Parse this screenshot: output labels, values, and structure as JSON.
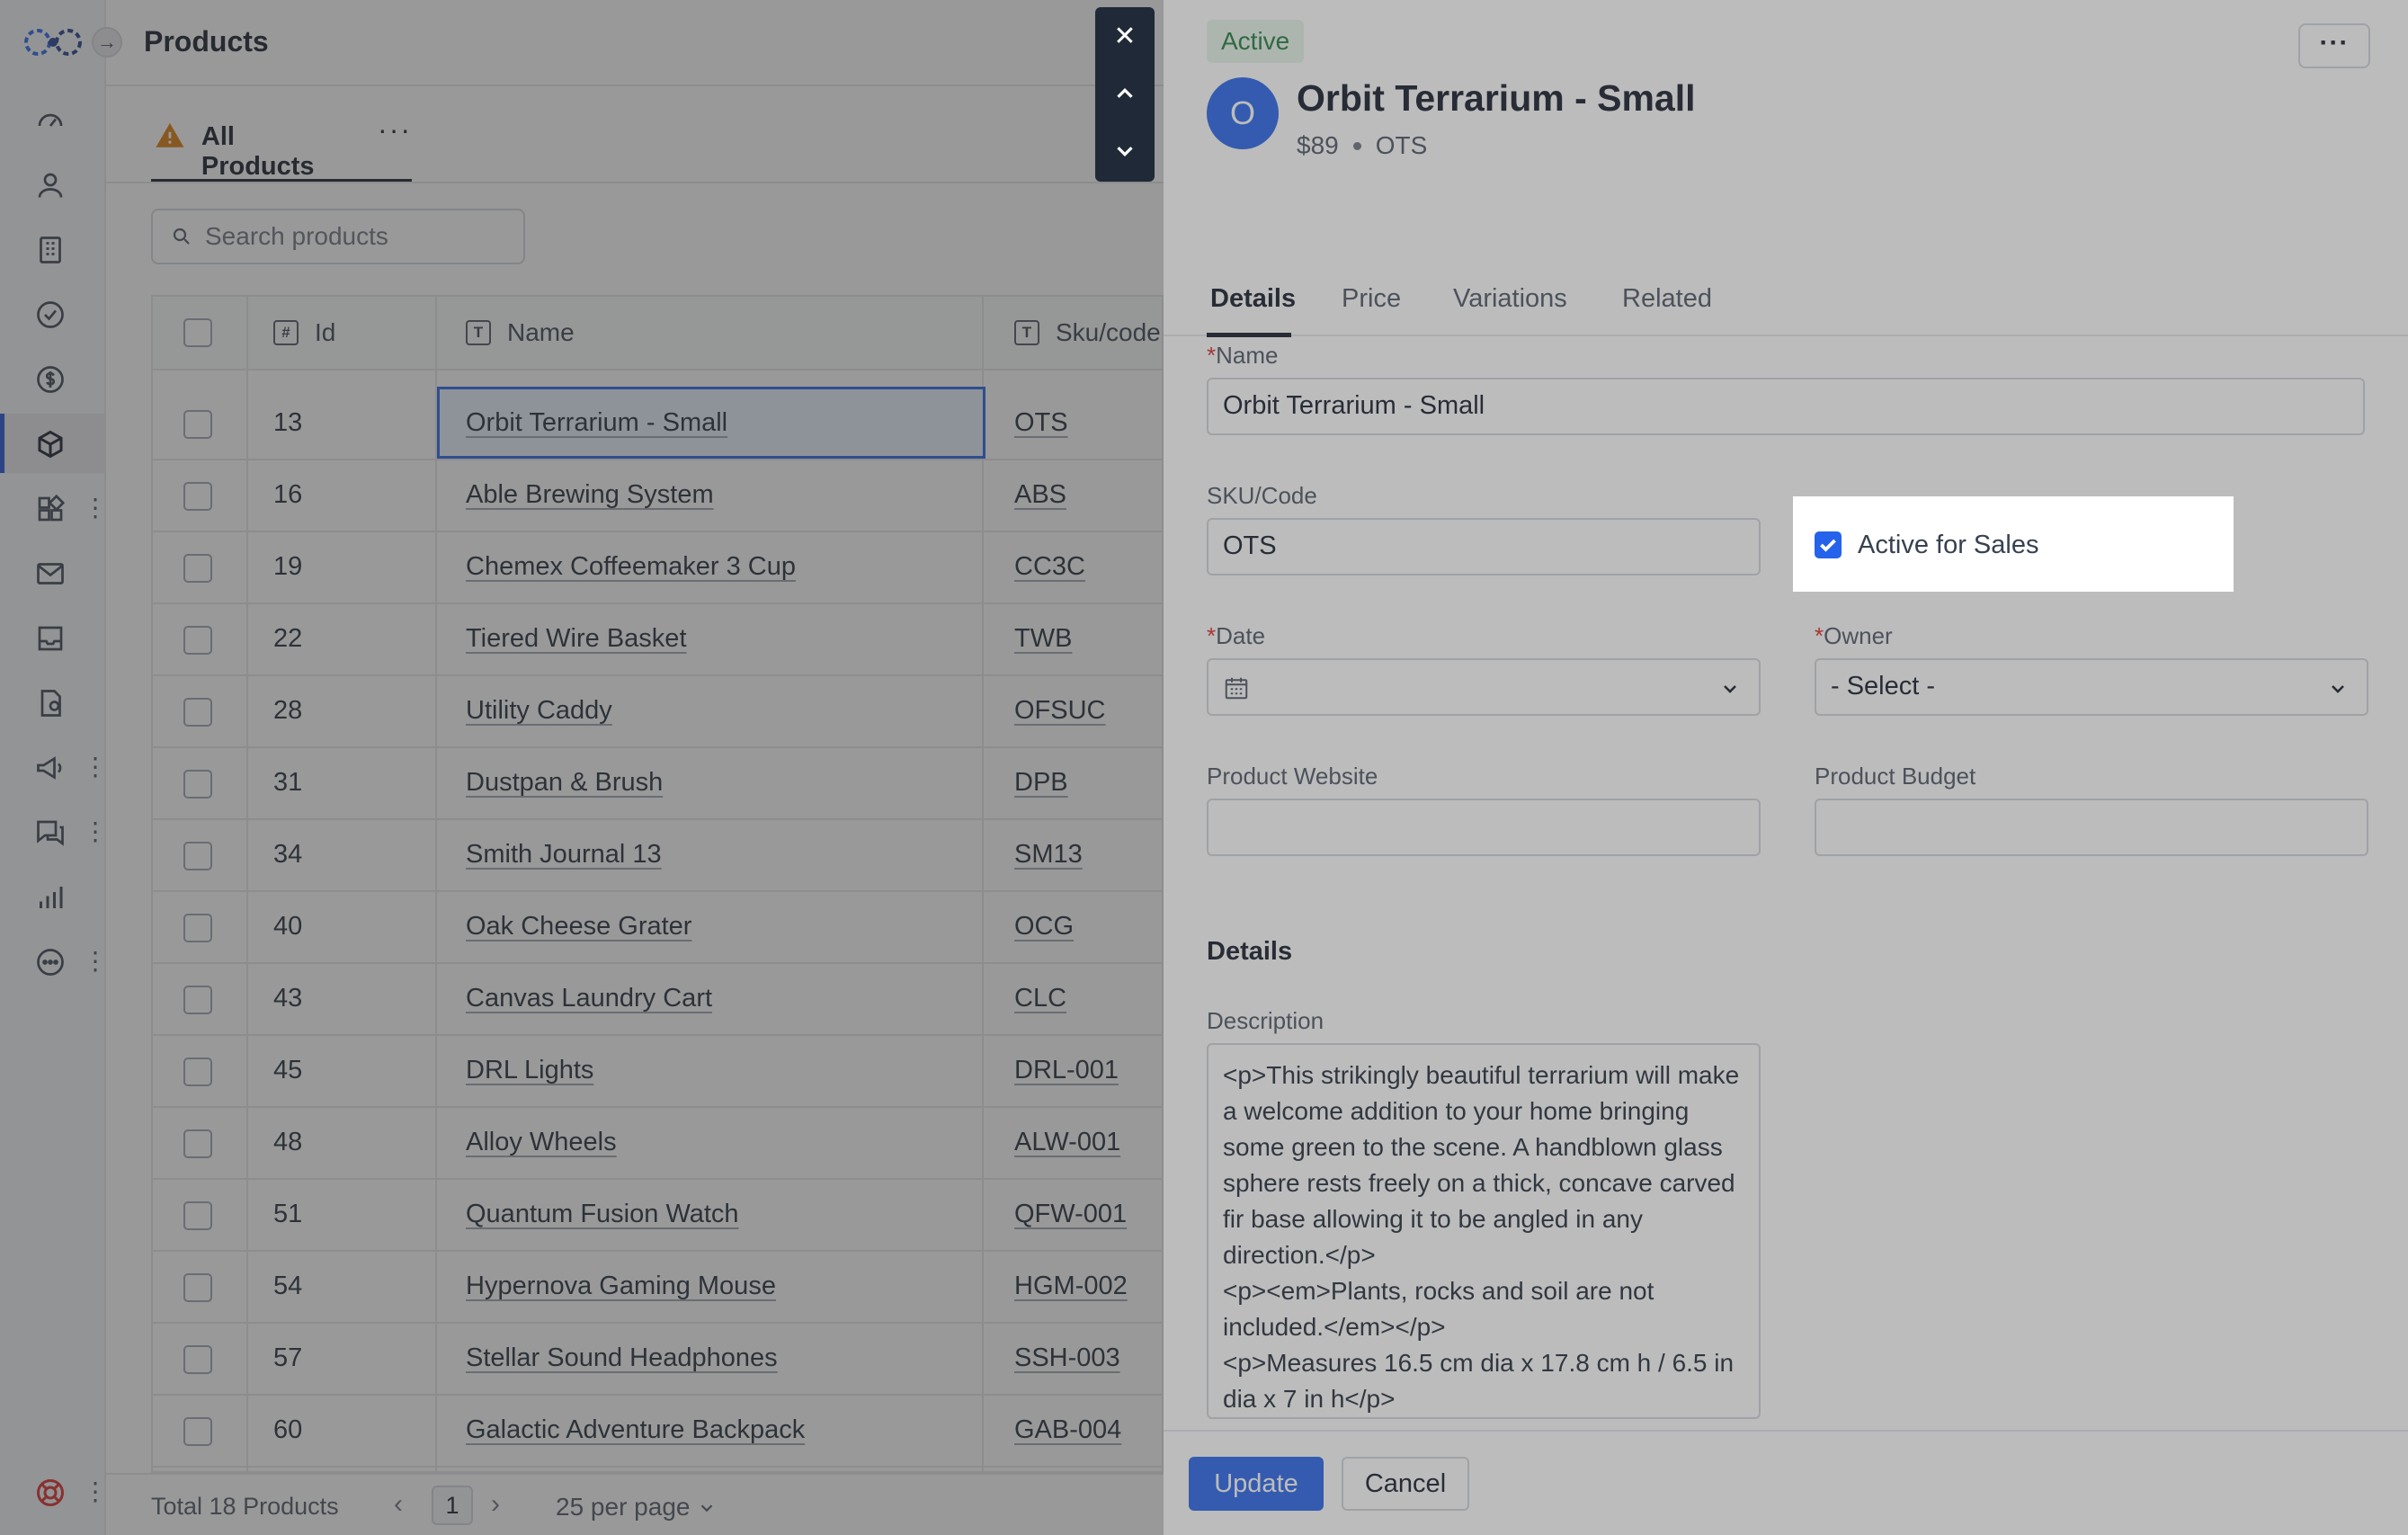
{
  "app": {
    "page_title": "Products",
    "view_tab_label": "All Products",
    "view_tab_more": "···",
    "collapse_glyph": "→"
  },
  "sidebar": {
    "icons": [
      "dashboard-icon",
      "contacts-icon",
      "companies-icon",
      "tasks-icon",
      "deals-icon",
      "products-icon",
      "apps-icon",
      "mail-icon",
      "inbox-icon",
      "documents-icon",
      "campaigns-icon",
      "chat-icon",
      "reports-icon",
      "more-icon",
      "help-icon"
    ],
    "dots": "⋮"
  },
  "search": {
    "placeholder": "Search products"
  },
  "table": {
    "columns": [
      {
        "icon": "#",
        "label": "Id"
      },
      {
        "icon": "T",
        "label": "Name"
      },
      {
        "icon": "T",
        "label": "Sku/code"
      }
    ],
    "rows": [
      {
        "id": "13",
        "name": "Orbit Terrarium - Small",
        "sku": "OTS"
      },
      {
        "id": "16",
        "name": "Able Brewing System",
        "sku": "ABS"
      },
      {
        "id": "19",
        "name": "Chemex Coffeemaker 3 Cup",
        "sku": "CC3C"
      },
      {
        "id": "22",
        "name": "Tiered Wire Basket",
        "sku": "TWB"
      },
      {
        "id": "28",
        "name": "Utility Caddy",
        "sku": "OFSUC"
      },
      {
        "id": "31",
        "name": "Dustpan & Brush",
        "sku": "DPB"
      },
      {
        "id": "34",
        "name": "Smith Journal 13",
        "sku": "SM13"
      },
      {
        "id": "40",
        "name": "Oak Cheese Grater",
        "sku": "OCG"
      },
      {
        "id": "43",
        "name": "Canvas Laundry Cart",
        "sku": "CLC"
      },
      {
        "id": "45",
        "name": "DRL Lights",
        "sku": "DRL-001"
      },
      {
        "id": "48",
        "name": "Alloy Wheels",
        "sku": "ALW-001"
      },
      {
        "id": "51",
        "name": "Quantum Fusion Watch",
        "sku": "QFW-001"
      },
      {
        "id": "54",
        "name": "Hypernova Gaming Mouse",
        "sku": "HGM-002"
      },
      {
        "id": "57",
        "name": "Stellar Sound Headphones",
        "sku": "SSH-003"
      },
      {
        "id": "60",
        "name": "Galactic Adventure Backpack",
        "sku": "GAB-004"
      }
    ]
  },
  "footer": {
    "total": "Total 18 Products",
    "prev": "‹",
    "current_page": "1",
    "next": "›",
    "per_page": "25 per page"
  },
  "record_nav": {
    "close": "✕"
  },
  "drawer": {
    "status": "Active",
    "kebab": "···",
    "avatar_initial": "O",
    "title": "Orbit Terrarium - Small",
    "price": "$89",
    "sku_short": "OTS",
    "tabs": [
      "Details",
      "Price",
      "Variations",
      "Related"
    ],
    "fields": {
      "name_label": "Name",
      "name_value": "Orbit Terrarium - Small",
      "sku_label": "SKU/Code",
      "sku_value": "OTS",
      "active_label": "Active for Sales",
      "active_checked": true,
      "date_label": "Date",
      "owner_label": "Owner",
      "owner_value": "- Select -",
      "website_label": "Product Website",
      "budget_label": "Product Budget",
      "required_mark": "*"
    },
    "details_heading": "Details",
    "description_label": "Description",
    "description_value": "<p>This strikingly beautiful terrarium will make a welcome addition to your home bringing some green to the scene. A handblown glass sphere rests freely on a thick, concave carved fir base allowing it to be angled in any direction.</p>\n<p><em>Plants, rocks and soil are not included.</em></p>\n<p>Measures 16.5 cm dia x 17.8 cm h / 6.5 in dia x 7 in h</p>",
    "update_label": "Update",
    "cancel_label": "Cancel"
  },
  "colors": {
    "accent": "#2563eb",
    "status_green_bg": "#e6f5ea",
    "status_green_text": "#1f7a3a",
    "required": "#dc2626",
    "warning": "#d97706"
  }
}
